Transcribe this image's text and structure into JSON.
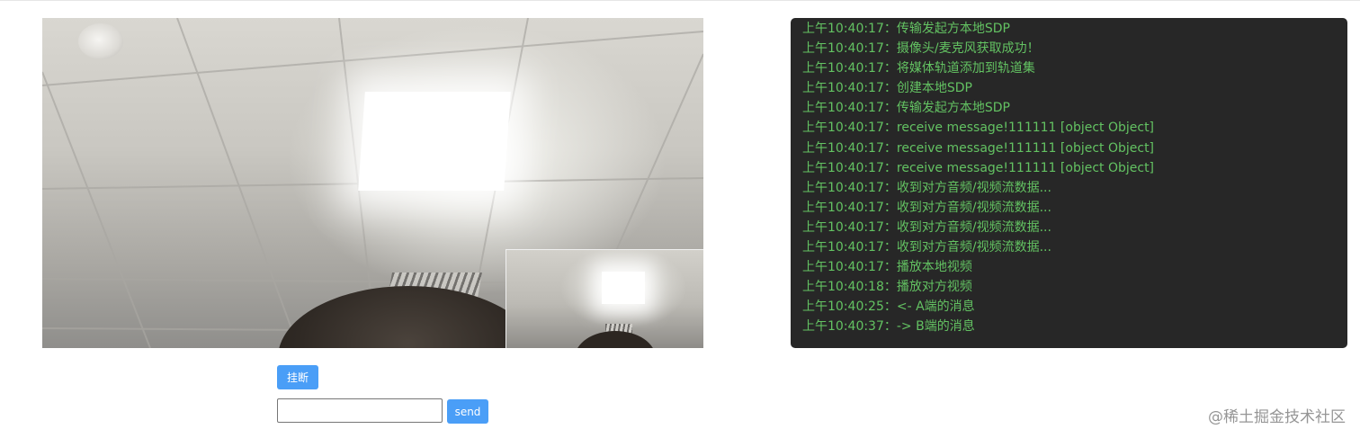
{
  "controls": {
    "hangup_label": "挂断",
    "send_label": "send",
    "message_input_value": "",
    "accent_color": "#4a9ef7"
  },
  "log": {
    "text_color": "#63c262",
    "background_color": "#272727",
    "entries": [
      "上午10:40:17：传输发起方本地SDP",
      "上午10:40:17：摄像头/麦克风获取成功！",
      "上午10:40:17：将媒体轨道添加到轨道集",
      "上午10:40:17：创建本地SDP",
      "上午10:40:17：传输发起方本地SDP",
      "上午10:40:17：receive message!111111 [object Object]",
      "上午10:40:17：receive message!111111 [object Object]",
      "上午10:40:17：receive message!111111 [object Object]",
      "上午10:40:17：收到对方音频/视频流数据...",
      "上午10:40:17：收到对方音频/视频流数据...",
      "上午10:40:17：收到对方音频/视频流数据...",
      "上午10:40:17：收到对方音频/视频流数据...",
      "上午10:40:17：播放本地视频",
      "上午10:40:18：播放对方视频",
      "上午10:40:25：<- A端的消息",
      "上午10:40:37：-> B端的消息"
    ]
  },
  "watermark": {
    "text": "@稀土掘金技术社区"
  }
}
